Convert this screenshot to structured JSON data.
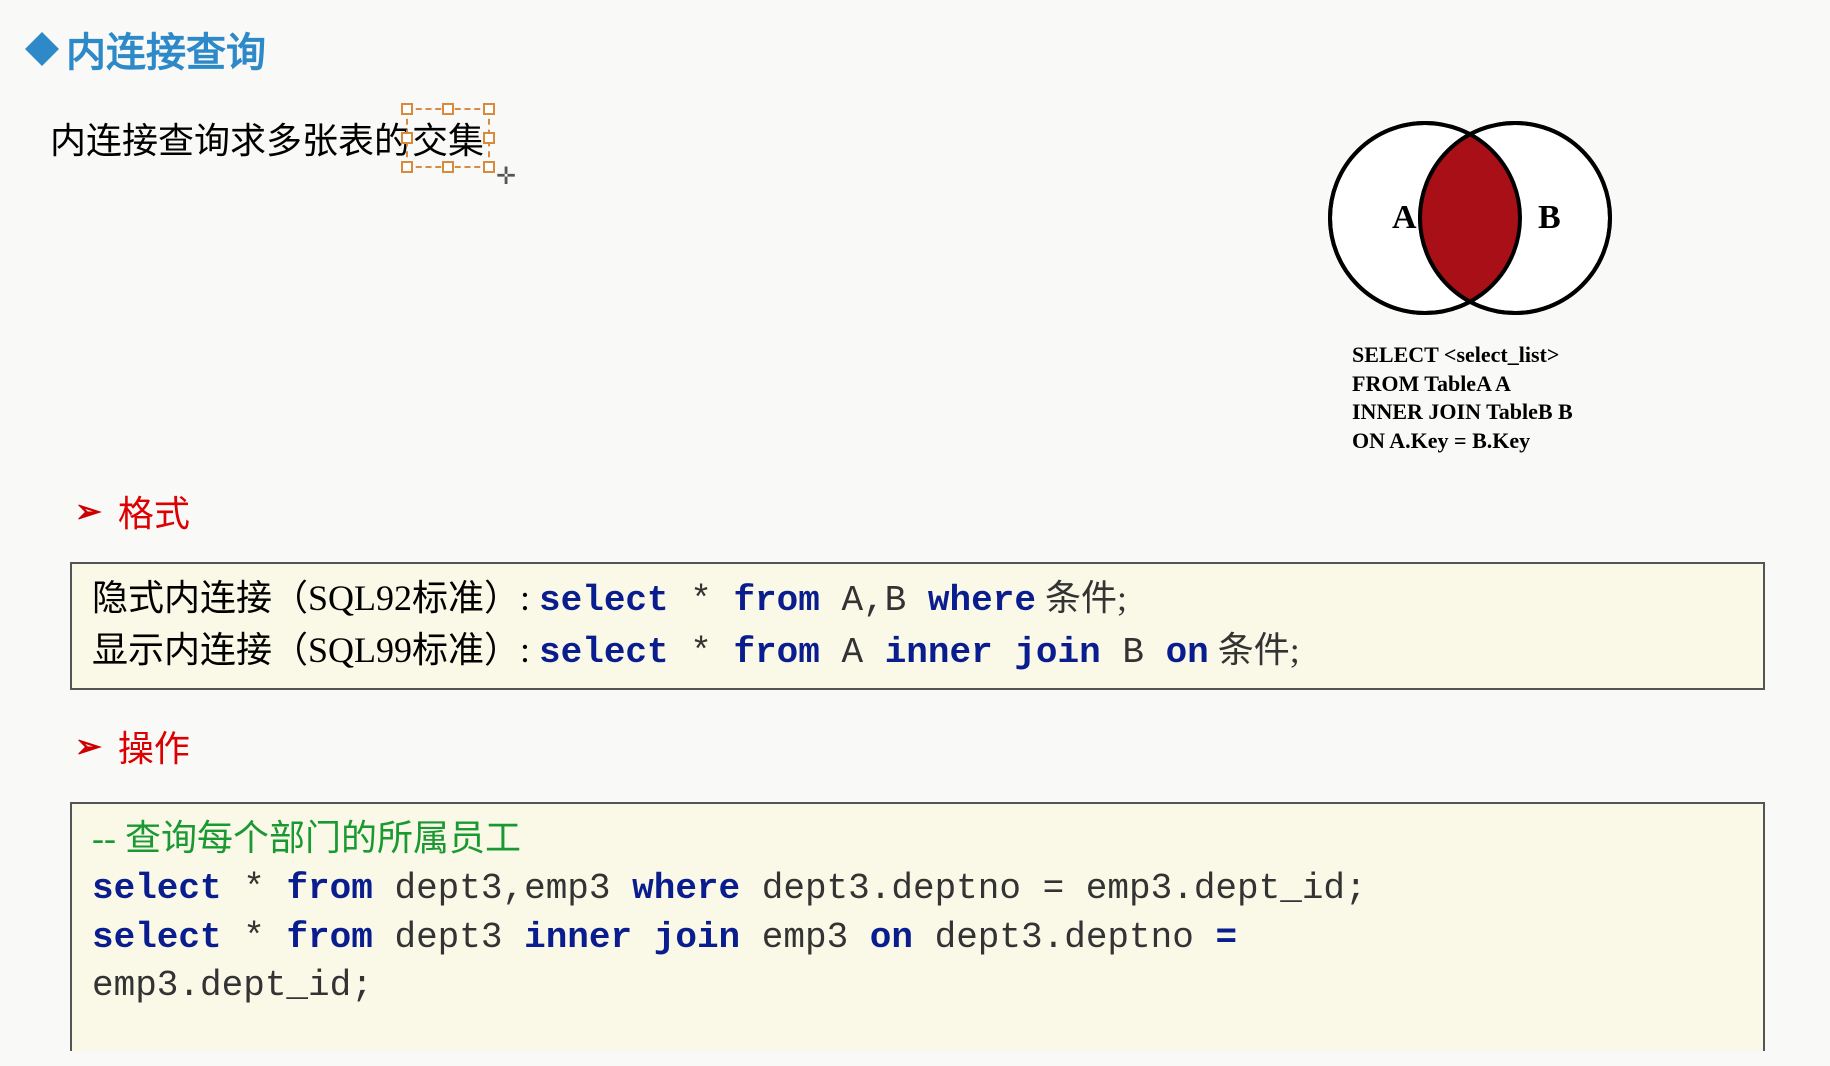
{
  "header": {
    "title": "内连接查询"
  },
  "description": {
    "prefix": "内连接查询求多张表的",
    "highlighted": "交集"
  },
  "venn": {
    "labelA": "A",
    "labelB": "B",
    "sql_line1": "SELECT <select_list>",
    "sql_line2": "FROM TableA A",
    "sql_line3": "INNER JOIN TableB B",
    "sql_line4": "ON A.Key = B.Key"
  },
  "sections": {
    "format": "格式",
    "operation": "操作"
  },
  "format_box": {
    "line1_label": "隐式内连接（SQL92标准）: ",
    "line1_kw1": "select",
    "line1_star": " * ",
    "line1_kw2": "from",
    "line1_tables": " A,B ",
    "line1_kw3": "where",
    "line1_cond": " 条件;",
    "line2_label": "显示内连接（SQL99标准）: ",
    "line2_kw1": "select",
    "line2_star": " * ",
    "line2_kw2": "from",
    "line2_tableA": " A ",
    "line2_kw3": "inner",
    "line2_sp1": " ",
    "line2_kw4": "join",
    "line2_tableB": " B ",
    "line2_kw5": "on",
    "line2_cond": " 条件;"
  },
  "op_box": {
    "comment": "-- 查询每个部门的所属员工",
    "l1_kw1": "select",
    "l1_star": " * ",
    "l1_kw2": "from",
    "l1_tables": " dept3,emp3 ",
    "l1_kw3": "where",
    "l1_cond": " dept3.deptno = emp3.dept_id;",
    "l2_kw1": "select",
    "l2_star": " * ",
    "l2_kw2": "from",
    "l2_t1": " dept3 ",
    "l2_kw3": "inner",
    "l2_sp1": " ",
    "l2_kw4": "join",
    "l2_t2": " emp3 ",
    "l2_kw5": "on",
    "l2_cond1": " dept3.deptno ",
    "l2_eq": "=",
    "l3_cond": "emp3.dept_id;"
  }
}
